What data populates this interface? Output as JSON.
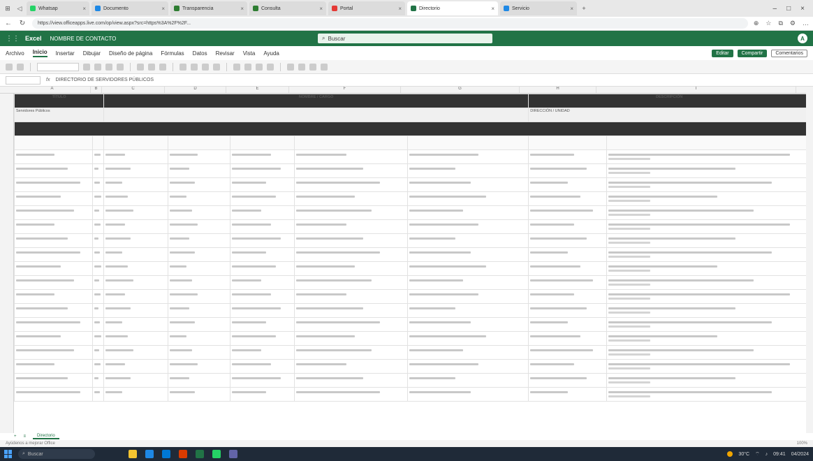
{
  "browser": {
    "tabs": [
      {
        "label": "Whatsap",
        "color": "#25d366",
        "active": false
      },
      {
        "label": "Documento",
        "color": "#1e88e5",
        "active": false
      },
      {
        "label": "Transparencia",
        "color": "#2e7d32",
        "active": false
      },
      {
        "label": "Consulta",
        "color": "#2e7d32",
        "active": false
      },
      {
        "label": "Portal",
        "color": "#e53935",
        "active": false
      },
      {
        "label": "Directorio",
        "color": "#217346",
        "active": true
      },
      {
        "label": "Servicio",
        "color": "#1e88e5",
        "active": false
      }
    ],
    "url": "https://view.officeapps.live.com/op/view.aspx?src=https%3A%2F%2F..."
  },
  "excel": {
    "app_name": "Excel",
    "file_name": "NOMBRE DE CONTACTO",
    "search_placeholder": "Buscar",
    "avatar": "A",
    "menu": [
      "Archivo",
      "Inicio",
      "Insertar",
      "Dibujar",
      "Diseño de página",
      "Fórmulas",
      "Datos",
      "Revisar",
      "Vista",
      "Ayuda"
    ],
    "active_menu_index": 1,
    "btn_edit": "Editar",
    "btn_share": "Compartir",
    "btn_comments": "Comentarios",
    "formula_text": "DIRECTORIO DE SERVIDORES PÚBLICOS"
  },
  "sheet": {
    "header_row": [
      "TÍTULO",
      "NOMBRE / CARGO",
      "DESCRIPCIÓN"
    ],
    "sub_header": [
      "Servidores Públicos",
      "",
      "DIRECCIÓN / UNIDAD"
    ],
    "rows_count": 18,
    "tab_name": "Directorio"
  },
  "status": {
    "left": "Ayúdenos a mejorar Office",
    "right": "100%"
  },
  "taskbar": {
    "search": "Buscar",
    "weather": "30°C",
    "time": "09:41",
    "date": "04/2024"
  }
}
